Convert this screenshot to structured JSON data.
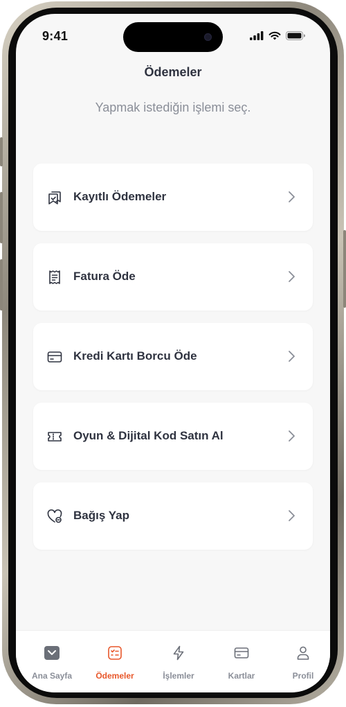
{
  "status_bar": {
    "time": "9:41"
  },
  "header": {
    "title": "Ödemeler",
    "subtitle": "Yapmak istediğin işlemi seç."
  },
  "menu": {
    "items": [
      {
        "label": "Kayıtlı Ödemeler",
        "icon": "saved-payments-icon"
      },
      {
        "label": "Fatura Öde",
        "icon": "bill-receipt-icon"
      },
      {
        "label": "Kredi Kartı Borcu Öde",
        "icon": "credit-card-icon"
      },
      {
        "label": "Oyun & Dijital Kod Satın Al",
        "icon": "ticket-icon"
      },
      {
        "label": "Bağış Yap",
        "icon": "heart-donation-icon"
      }
    ]
  },
  "tabbar": {
    "tabs": [
      {
        "label": "Ana Sayfa",
        "icon": "home-icon"
      },
      {
        "label": "Ödemeler",
        "icon": "payments-icon",
        "active": true
      },
      {
        "label": "İşlemler",
        "icon": "lightning-icon"
      },
      {
        "label": "Kartlar",
        "icon": "card-icon"
      },
      {
        "label": "Profil",
        "icon": "profile-icon"
      }
    ]
  },
  "colors": {
    "accent": "#e8572a",
    "text_primary": "#2f3340",
    "text_secondary": "#8a8e98",
    "background": "#f7f7f7",
    "card": "#ffffff"
  }
}
